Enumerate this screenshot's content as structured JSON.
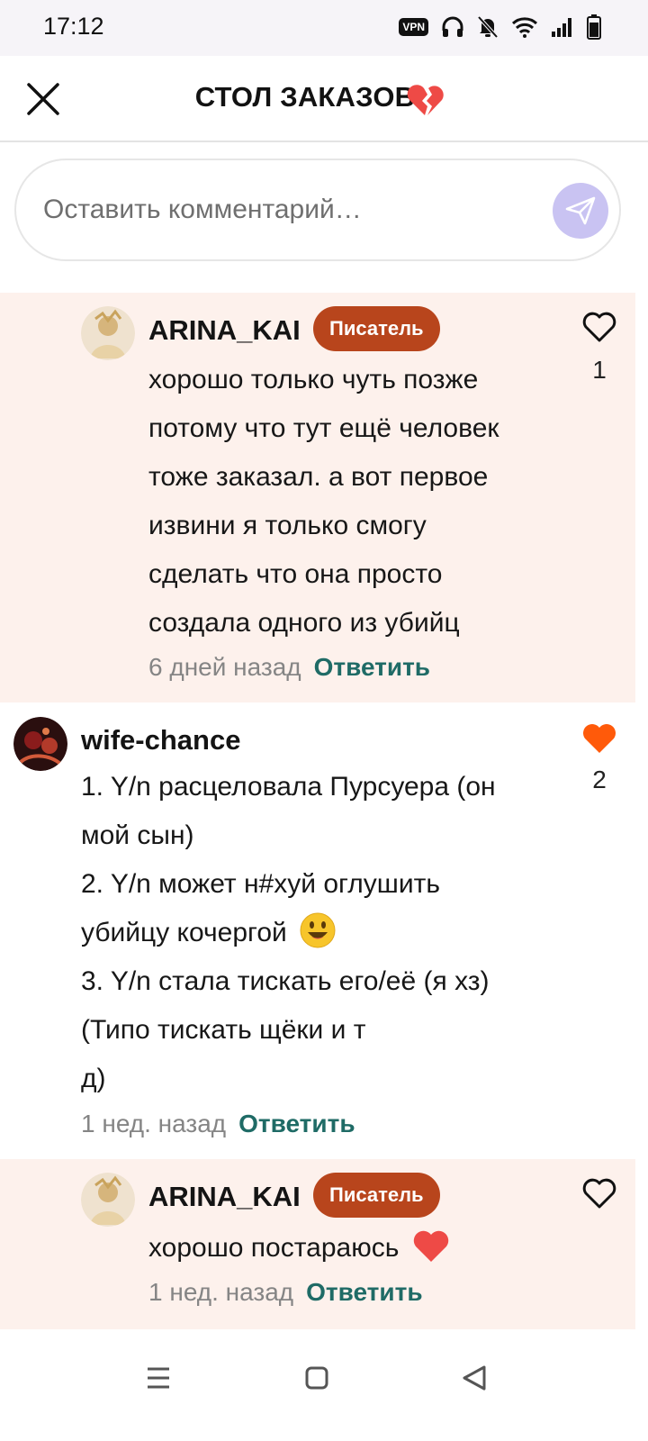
{
  "status_bar": {
    "time": "17:12",
    "vpn_label": "VPN",
    "icons": [
      "vpn-icon",
      "headphones-icon",
      "bell-muted-icon",
      "wifi-icon",
      "signal-icon",
      "battery-icon"
    ]
  },
  "header": {
    "title": "СТОЛ ЗАКАЗОВ",
    "title_emoji": "broken-heart-icon",
    "close_icon": "close-icon"
  },
  "composer": {
    "placeholder": "Оставить комментарий…",
    "send_icon": "send-icon",
    "send_color": "#c9c3f2"
  },
  "colors": {
    "badge": "#b8451c",
    "reply_background": "#fdf1ec",
    "reply_link": "#1f6b66",
    "liked_heart": "#ff5a0a"
  },
  "comments": [
    {
      "username": "ARINA_KAI",
      "badge": "Писатель",
      "lines": [
        "хорошо только чуть позже",
        "потому что тут ещё человек",
        "тоже заказал. а вот первое",
        "извини я только смогу",
        "сделать что она просто",
        "создала одного из убийц"
      ],
      "time": "6 дней назад",
      "reply_label": "Ответить",
      "likes": "1",
      "liked": false
    },
    {
      "username": "wife-chance",
      "lines": [
        "1. Y/n расцеловала Пурсуера (он",
        "мой сын)",
        "2. Y/n может н#хуй оглушить",
        "убийцу кочергой",
        "3. Y/n стала тискать его/её (я хз)",
        "(Типо тискать щёки и т",
        "д)"
      ],
      "time": "1 нед. назад",
      "reply_label": "Ответить",
      "likes": "2",
      "liked": true
    },
    {
      "username": "ARINA_KAI",
      "badge": "Писатель",
      "lines": [
        "хорошо постараюсь"
      ],
      "time": "1 нед. назад",
      "reply_label": "Ответить",
      "liked": false
    }
  ],
  "nav_bar": {
    "icons": [
      "menu-icon",
      "home-square-icon",
      "back-triangle-icon"
    ]
  }
}
